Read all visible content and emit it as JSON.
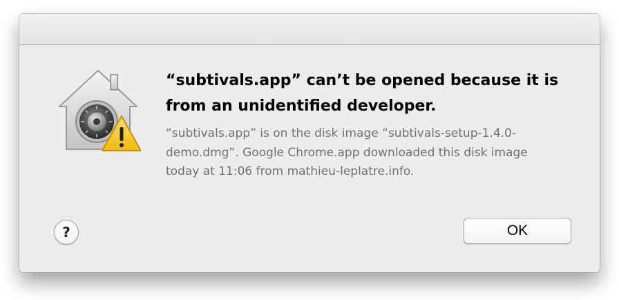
{
  "dialog": {
    "heading": "“subtivals.app” can’t be opened because it is from an unidentified developer.",
    "message": "“subtivals.app” is on the disk image “subtivals-setup-1.4.0-demo.dmg”. Google Chrome.app downloaded this disk image today at 11:06 from mathieu-leplatre.info.",
    "icon": "gatekeeper-security-icon",
    "warning_icon": "warning-triangle-icon"
  },
  "buttons": {
    "help_label": "?",
    "ok_label": "OK"
  },
  "colors": {
    "dialog_background": "#ececec",
    "warning_yellow": "#f5c51f",
    "body_text": "#717171"
  }
}
